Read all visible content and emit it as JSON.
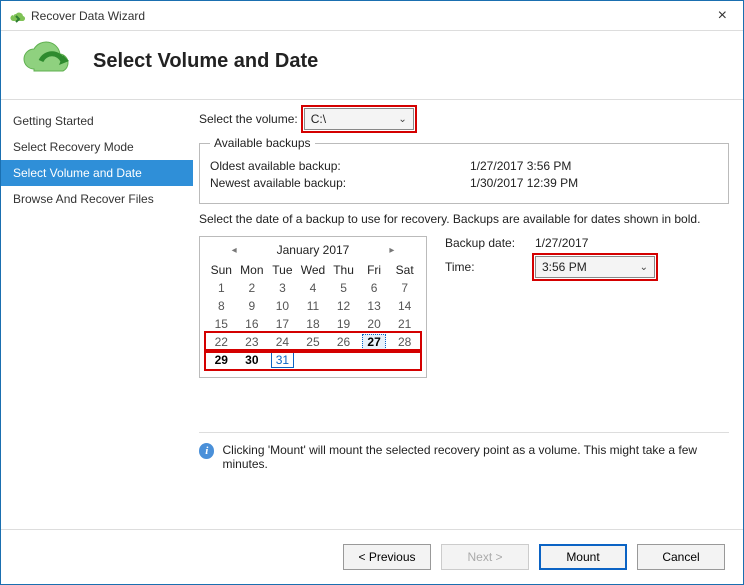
{
  "window": {
    "title": "Recover Data Wizard"
  },
  "header": {
    "title": "Select Volume and Date"
  },
  "sidebar": {
    "items": [
      {
        "label": "Getting Started"
      },
      {
        "label": "Select Recovery Mode"
      },
      {
        "label": "Select Volume and Date"
      },
      {
        "label": "Browse And Recover Files"
      }
    ],
    "selected_index": 2
  },
  "volume": {
    "label": "Select the volume:",
    "value": "C:\\"
  },
  "available": {
    "legend": "Available backups",
    "oldest_label": "Oldest available backup:",
    "oldest_value": "1/27/2017 3:56 PM",
    "newest_label": "Newest available backup:",
    "newest_value": "1/30/2017 12:39 PM"
  },
  "instruction": "Select the date of a backup to use for recovery. Backups are available for dates shown in bold.",
  "calendar": {
    "month_label": "January 2017",
    "dow": [
      "Sun",
      "Mon",
      "Tue",
      "Wed",
      "Thu",
      "Fri",
      "Sat"
    ],
    "weeks": [
      [
        {
          "n": 1
        },
        {
          "n": 2
        },
        {
          "n": 3
        },
        {
          "n": 4
        },
        {
          "n": 5
        },
        {
          "n": 6
        },
        {
          "n": 7
        }
      ],
      [
        {
          "n": 8
        },
        {
          "n": 9
        },
        {
          "n": 10
        },
        {
          "n": 11
        },
        {
          "n": 12
        },
        {
          "n": 13
        },
        {
          "n": 14
        }
      ],
      [
        {
          "n": 15
        },
        {
          "n": 16
        },
        {
          "n": 17
        },
        {
          "n": 18
        },
        {
          "n": 19
        },
        {
          "n": 20
        },
        {
          "n": 21
        }
      ],
      [
        {
          "n": 22
        },
        {
          "n": 23
        },
        {
          "n": 24
        },
        {
          "n": 25
        },
        {
          "n": 26
        },
        {
          "n": 27,
          "bold": true,
          "selected": true
        },
        {
          "n": 28
        }
      ],
      [
        {
          "n": 29,
          "bold": true
        },
        {
          "n": 30,
          "bold": true
        },
        {
          "n": 31,
          "today": true
        },
        {
          "n": ""
        },
        {
          "n": ""
        },
        {
          "n": ""
        },
        {
          "n": ""
        }
      ]
    ],
    "highlight_rows": [
      3,
      4
    ]
  },
  "meta": {
    "backup_date_label": "Backup date:",
    "backup_date_value": "1/27/2017",
    "time_label": "Time:",
    "time_value": "3:56 PM"
  },
  "info_text": "Clicking 'Mount' will mount the selected recovery point as a volume. This might take a few minutes.",
  "buttons": {
    "previous": "< Previous",
    "next": "Next >",
    "mount": "Mount",
    "cancel": "Cancel"
  }
}
